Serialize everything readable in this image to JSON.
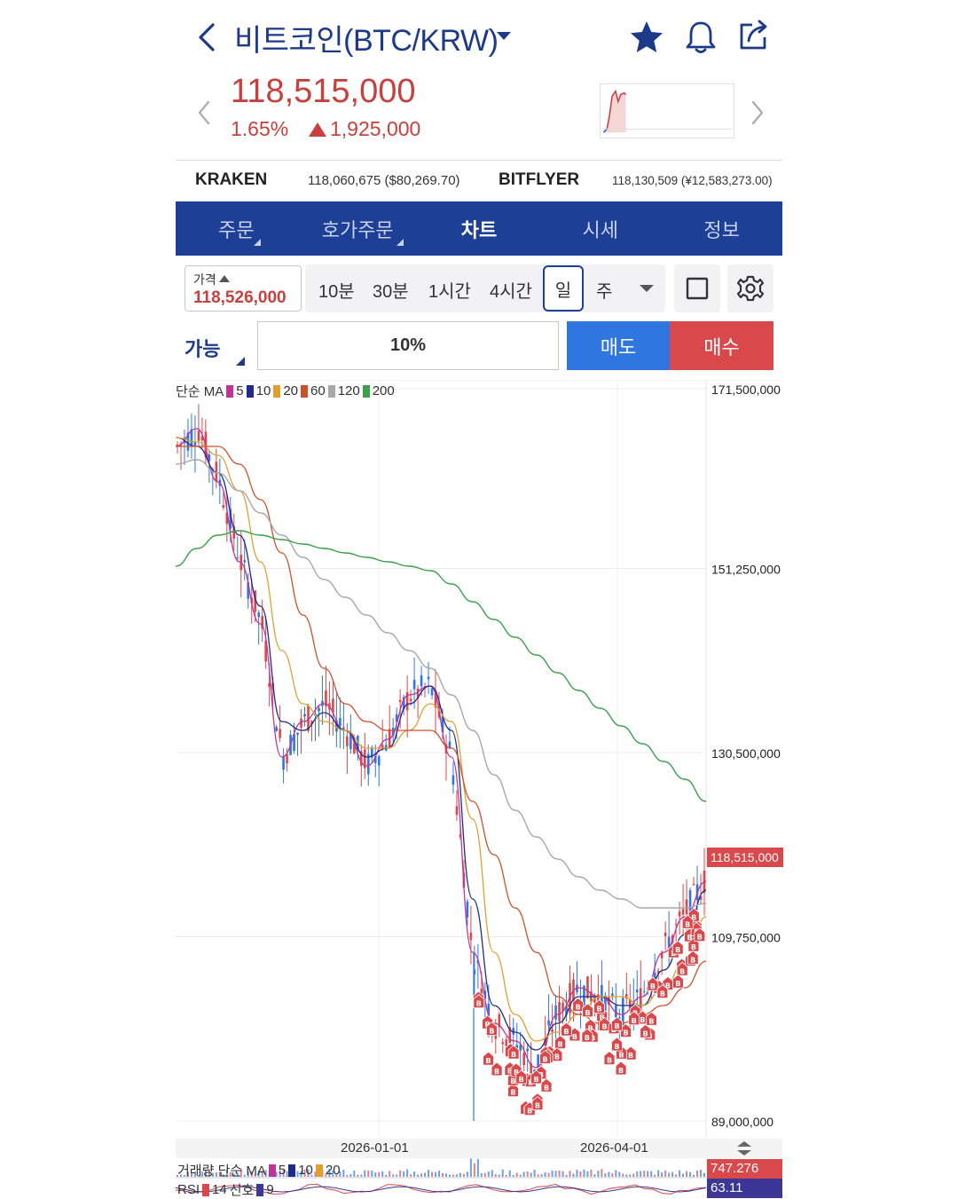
{
  "header": {
    "title": "비트코인(BTC/KRW)",
    "price": "118,515,000",
    "change_pct": "1.65%",
    "change_amt": "1,925,000",
    "colors": {
      "up": "#c8403e",
      "brand": "#1e3f96"
    }
  },
  "exchanges": [
    {
      "name": "KRAKEN",
      "value": "118,060,675 ($80,269.70)"
    },
    {
      "name": "BITFLYER",
      "value": "118,130,509 (¥12,583,273.00)"
    }
  ],
  "tabs": [
    {
      "label": "주문",
      "active": false
    },
    {
      "label": "호가주문",
      "active": false
    },
    {
      "label": "차트",
      "active": true
    },
    {
      "label": "시세",
      "active": false
    },
    {
      "label": "정보",
      "active": false
    }
  ],
  "toolbar": {
    "price_label": "가격",
    "price_value": "118,526,000",
    "timeframes": [
      "10분",
      "30분",
      "1시간",
      "4시간",
      "일",
      "주"
    ],
    "selected_timeframe": "일",
    "icons": [
      "square-icon",
      "gear-icon"
    ]
  },
  "order": {
    "available_label": "가능",
    "percent": "10%",
    "sell_label": "매도",
    "buy_label": "매수"
  },
  "chart_labels": {
    "ma_prefix": "단순 MA",
    "volume_prefix": "거래량 단순 MA",
    "rsi_prefix": "RSI",
    "rsi_period": "14",
    "rsi_signal_label": "신호",
    "rsi_signal": "9",
    "volume_value": "747.276",
    "rsi_value": "63.11",
    "last_price_tag": "118,515,000"
  },
  "chart_data": {
    "type": "line",
    "y_ticks": [
      "171,500,000",
      "151,250,000",
      "130,500,000",
      "109,750,000",
      "89,000,000"
    ],
    "ylim": [
      89000000,
      171500000
    ],
    "x_ticks": [
      "2026-01-01",
      "2026-04-01"
    ],
    "ma_periods": [
      {
        "period": "5",
        "color": "#c0349a"
      },
      {
        "period": "10",
        "color": "#1f2a8a"
      },
      {
        "period": "20",
        "color": "#e0a030"
      },
      {
        "period": "60",
        "color": "#d0502a"
      },
      {
        "period": "120",
        "color": "#a8a8a8"
      },
      {
        "period": "200",
        "color": "#3aa04a"
      }
    ],
    "volume_ma_periods": [
      {
        "period": "5",
        "color": "#c0349a"
      },
      {
        "period": "10",
        "color": "#1f2a8a"
      },
      {
        "period": "20",
        "color": "#e0a030"
      }
    ],
    "series": [
      {
        "name": "5",
        "color": "#c0349a",
        "values": [
          165000000,
          167000000,
          161000000,
          152000000,
          145000000,
          130000000,
          134000000,
          136000000,
          133000000,
          129000000,
          132000000,
          137000000,
          138000000,
          130000000,
          108000000,
          100000000,
          98000000,
          95000000,
          101000000,
          104000000,
          103000000,
          101000000,
          103000000,
          108000000,
          112000000,
          116000000
        ]
      },
      {
        "name": "10",
        "color": "#1f2a8a",
        "values": [
          166000000,
          165000000,
          162000000,
          155000000,
          147000000,
          134000000,
          133000000,
          135000000,
          133000000,
          130000000,
          131000000,
          136000000,
          138000000,
          133000000,
          114000000,
          102000000,
          99000000,
          97000000,
          100000000,
          103000000,
          103000000,
          102000000,
          102000000,
          106000000,
          110000000,
          115000000
        ]
      },
      {
        "name": "20",
        "color": "#e0a030",
        "values": [
          166000000,
          165500000,
          164000000,
          160000000,
          152000000,
          142000000,
          136000000,
          134000000,
          133000000,
          131000000,
          131000000,
          133000000,
          136000000,
          134000000,
          123000000,
          108000000,
          101000000,
          98000000,
          99000000,
          101000000,
          103000000,
          103000000,
          102000000,
          104000000,
          107000000,
          112000000
        ]
      },
      {
        "name": "60",
        "color": "#d0502a",
        "values": [
          165000000,
          165000000,
          165000000,
          163000000,
          159000000,
          153000000,
          146000000,
          140000000,
          136000000,
          134000000,
          133000000,
          133000000,
          133000000,
          131000000,
          125000000,
          119000000,
          113000000,
          108000000,
          103000000,
          101000000,
          100000000,
          100000000,
          101000000,
          102000000,
          104000000,
          107000000
        ]
      },
      {
        "name": "120",
        "color": "#a8a8a8",
        "values": [
          163000000,
          163500000,
          162000000,
          160000000,
          157500000,
          155000000,
          152500000,
          150000000,
          148000000,
          146000000,
          144000000,
          142000000,
          140000000,
          137000000,
          133000000,
          128000000,
          124000000,
          121000000,
          118500000,
          116500000,
          115000000,
          114000000,
          113000000,
          113000000,
          113000000,
          113500000
        ]
      },
      {
        "name": "200",
        "color": "#3aa04a",
        "values": [
          151500000,
          153500000,
          155000000,
          155500000,
          155000000,
          154500000,
          154000000,
          153500000,
          153000000,
          152500000,
          152000000,
          151500000,
          151000000,
          149500000,
          147500000,
          145500000,
          143500000,
          141500000,
          139500000,
          137500000,
          135500000,
          133500000,
          131500000,
          129500000,
          127500000,
          125000000
        ]
      }
    ]
  }
}
